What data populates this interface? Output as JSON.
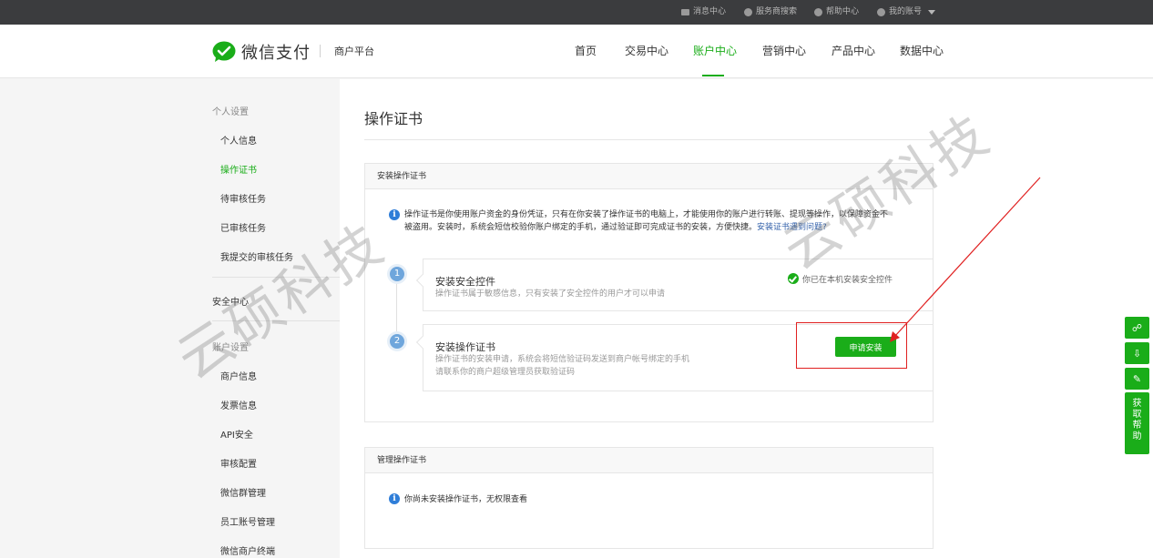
{
  "topbar": {
    "items": [
      "消息中心",
      "服务商搜索",
      "帮助中心",
      "我的账号"
    ]
  },
  "header": {
    "logo_text": "微信支付",
    "platform": "商户平台",
    "nav": [
      "首页",
      "交易中心",
      "账户中心",
      "营销中心",
      "产品中心",
      "数据中心"
    ],
    "active_nav": "账户中心",
    "brand_color": "#1aad19"
  },
  "sidebar": {
    "group_personal": "个人设置",
    "personal_items": [
      "个人信息",
      "操作证书",
      "待审核任务",
      "已审核任务",
      "我提交的审核任务"
    ],
    "active_item": "操作证书",
    "security_center": "安全中心",
    "group_account": "账户设置",
    "account_items": [
      "商户信息",
      "发票信息",
      "API安全",
      "审核配置",
      "微信群管理",
      "员工账号管理",
      "微信商户终端"
    ]
  },
  "main": {
    "page_title": "操作证书",
    "install_card": {
      "title": "安装操作证书",
      "notice_line1": "操作证书是你使用账户资金的身份凭证，只有在你安装了操作证书的电脑上，才能使用你的账户进行转账、提现等操作，以保障资金不",
      "notice_line2": "被盗用。安装时，系统会短信校验你账户绑定的手机，通过验证即可完成证书的安装，方便快捷。",
      "notice_link": "安装证书遇到问题?",
      "step1": {
        "num": "1",
        "title": "安装安全控件",
        "desc": "操作证书属于敏感信息，只有安装了安全控件的用户才可以申请",
        "status": "你已在本机安装安全控件"
      },
      "step2": {
        "num": "2",
        "title": "安装操作证书",
        "desc_line1": "操作证书的安装申请，系统会将短信验证码发送到商户帐号绑定的手机",
        "desc_line2": "请联系你的商户超级管理员获取验证码",
        "button": "申请安装"
      }
    },
    "manage_card": {
      "title": "管理操作证书",
      "notice": "你尚未安装操作证书，无权限查看"
    }
  },
  "watermark": {
    "text": "云硕科技"
  },
  "float_bar": {
    "help_chars": [
      "获",
      "取",
      "帮",
      "助"
    ]
  },
  "colors": {
    "annotation_red": "#e02020",
    "info_blue": "#2f7ed8"
  }
}
